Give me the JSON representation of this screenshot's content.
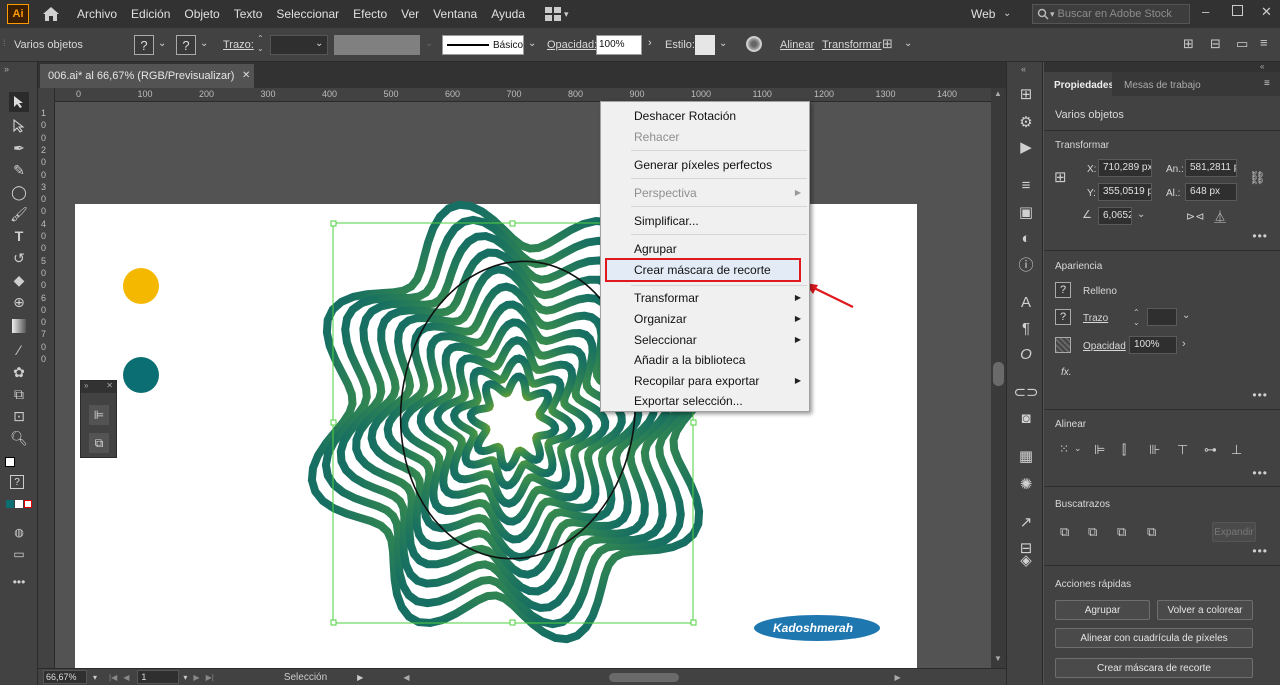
{
  "menubar": {
    "logo": "Ai",
    "items": [
      "Archivo",
      "Edición",
      "Objeto",
      "Texto",
      "Seleccionar",
      "Efecto",
      "Ver",
      "Ventana",
      "Ayuda"
    ],
    "workspace": "Web",
    "search_placeholder": "Buscar en Adobe Stock"
  },
  "controlbar": {
    "selection_label": "Varios objetos",
    "stroke_label": "Trazo:",
    "brush_label": "Básico",
    "opacity_label": "Opacidad:",
    "opacity_value": "100%",
    "style_label": "Estilo:",
    "align_label": "Alinear",
    "transform_label": "Transformar"
  },
  "document": {
    "tab_title": "006.ai* al 66,67% (RGB/Previsualizar)",
    "close": "✕"
  },
  "ruler": {
    "top": [
      "0",
      "100",
      "200",
      "300",
      "400",
      "500",
      "600",
      "700",
      "800",
      "900",
      "1000",
      "1100",
      "1200",
      "1300",
      "1400"
    ],
    "left": [
      "1",
      "0",
      "0",
      "2",
      "0",
      "0",
      "3",
      "0",
      "0",
      "4",
      "0",
      "0",
      "5",
      "0",
      "0",
      "6",
      "0",
      "0",
      "7",
      "0",
      "0"
    ]
  },
  "statusbar": {
    "zoom": "66,67%",
    "artboard": "1",
    "tool": "Selección"
  },
  "context_menu": {
    "items": [
      {
        "label": "Deshacer Rotación",
        "disabled": false
      },
      {
        "label": "Rehacer",
        "disabled": true
      },
      {
        "label": "Generar píxeles perfectos",
        "disabled": false
      },
      {
        "label": "Perspectiva",
        "disabled": true,
        "submenu": true
      },
      {
        "label": "Simplificar...",
        "disabled": false
      },
      {
        "label": "Agrupar",
        "disabled": false
      },
      {
        "label": "Crear máscara de recorte",
        "disabled": false,
        "highlighted": true
      },
      {
        "label": "Transformar",
        "disabled": false,
        "submenu": true
      },
      {
        "label": "Organizar",
        "disabled": false,
        "submenu": true
      },
      {
        "label": "Seleccionar",
        "disabled": false,
        "submenu": true
      },
      {
        "label": "Añadir a la biblioteca",
        "disabled": false
      },
      {
        "label": "Recopilar para exportar",
        "disabled": false,
        "submenu": true
      },
      {
        "label": "Exportar selección...",
        "disabled": false
      }
    ]
  },
  "watermark": "Kadoshmerah",
  "properties": {
    "tab_active": "Propiedades",
    "tab_other": "Mesas de trabajo",
    "selection": "Varios objetos",
    "transform": {
      "title": "Transformar",
      "x_label": "X:",
      "x": "710,289 px",
      "y_label": "Y:",
      "y": "355,0519 px",
      "w_label": "An.:",
      "w": "581,2811 p",
      "h_label": "Al.:",
      "h": "648 px",
      "angle": "6,0652°"
    },
    "appearance": {
      "title": "Apariencia",
      "fill": "Relleno",
      "stroke": "Trazo",
      "opacity": "Opacidad",
      "opacity_value": "100%",
      "fx": "fx."
    },
    "align": {
      "title": "Alinear"
    },
    "pathfinder": {
      "title": "Buscatrazos",
      "expand": "Expandir"
    },
    "quick_actions": {
      "title": "Acciones rápidas",
      "group": "Agrupar",
      "recolor": "Volver a colorear",
      "align_grid": "Alinear con cuadrícula de píxeles",
      "clip_mask": "Crear máscara de recorte"
    }
  },
  "colors": {
    "accent_yellow": "#f5b800",
    "accent_teal": "#0b6e72",
    "highlight_red": "#e0191f",
    "watermark_blue": "#1f77b0"
  }
}
